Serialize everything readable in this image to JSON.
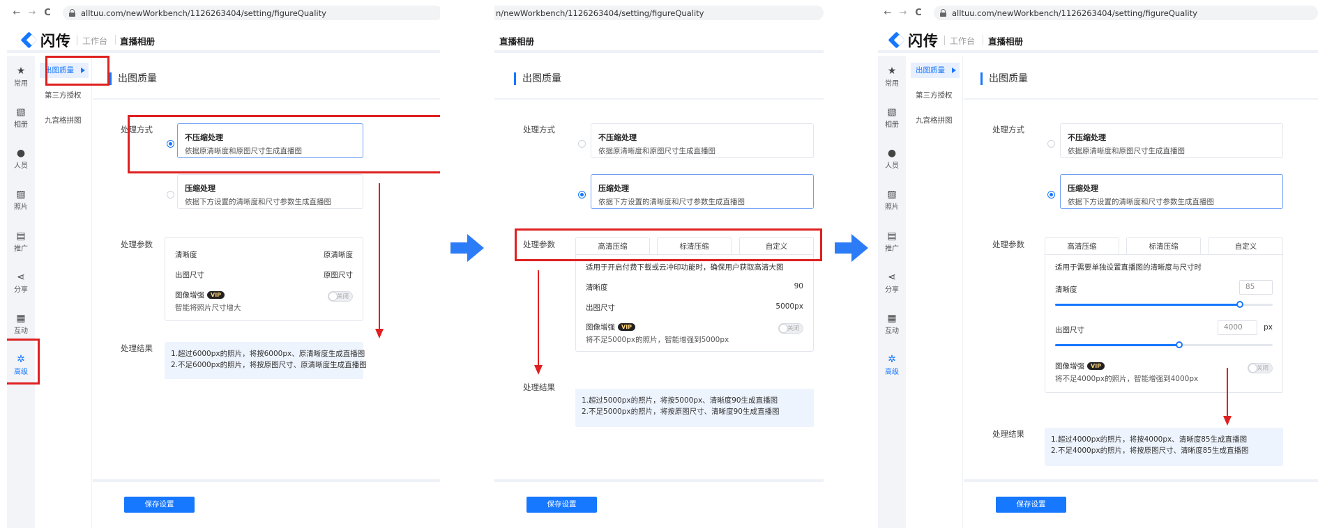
{
  "browser": {
    "back": "←",
    "forward": "→",
    "reload": "C",
    "url_full": "alltuu.com/newWorkbench/1126263404/setting/figureQuality",
    "url_scrolled": "n/newWorkbench/1126263404/setting/figureQuality"
  },
  "header": {
    "logo_name": "闪传",
    "logo_sub": "工作台",
    "title": "直播相册"
  },
  "icon_nav": [
    {
      "label": "常用",
      "icon": "star-icon",
      "glyph": "★"
    },
    {
      "label": "相册",
      "icon": "album-icon",
      "glyph": "▧"
    },
    {
      "label": "人员",
      "icon": "person-icon",
      "glyph": "●"
    },
    {
      "label": "照片",
      "icon": "photo-icon",
      "glyph": "▨"
    },
    {
      "label": "推广",
      "icon": "promote-icon",
      "glyph": "▤"
    },
    {
      "label": "分享",
      "icon": "share-icon",
      "glyph": "⋖"
    },
    {
      "label": "互动",
      "icon": "chat-icon",
      "glyph": "▦"
    },
    {
      "label": "高级",
      "icon": "gear-icon",
      "glyph": "✲"
    }
  ],
  "sub_nav": [
    "出图质量",
    "第三方授权",
    "九宫格拼图"
  ],
  "section_title": "出图质量",
  "labels": {
    "method": "处理方式",
    "params": "处理参数",
    "result": "处理结果"
  },
  "options": {
    "nocompress_title": "不压缩处理",
    "nocompress_desc": "依据原清晰度和原图尺寸生成直播图",
    "compress_title": "压缩处理",
    "compress_desc": "依据下方设置的清晰度和尺寸参数生成直播图"
  },
  "tabs": [
    "高清压缩",
    "标清压缩",
    "自定义"
  ],
  "panel1": {
    "clarity_label": "清晰度",
    "clarity_value": "原清晰度",
    "size_label": "出图尺寸",
    "size_value": "原图尺寸",
    "enhance_label": "图像增强",
    "enhance_desc": "智能将照片尺寸增大",
    "toggle_text": "关闭",
    "result_line1": "1.超过6000px的照片，将按6000px、原清晰度生成直播图",
    "result_line2": "2.不足6000px的照片，将按原图尺寸、原清晰度生成直播图"
  },
  "panel2": {
    "note": "适用于开启付费下载或云冲印功能时，确保用户获取高清大图",
    "clarity_label": "清晰度",
    "clarity_value": "90",
    "size_label": "出图尺寸",
    "size_value": "5000px",
    "enhance_label": "图像增强",
    "enhance_desc": "将不足5000px的照片，智能增强到5000px",
    "toggle_text": "关闭",
    "result_line1": "1.超过5000px的照片，将按5000px、清晰度90生成直播图",
    "result_line2": "2.不足5000px的照片，将按原图尺寸、清晰度90生成直播图"
  },
  "panel3": {
    "note": "适用于需要单独设置直播图的清晰度与尺寸时",
    "clarity_label": "清晰度",
    "clarity_value": "85",
    "clarity_fraction": 0.85,
    "size_label": "出图尺寸",
    "size_value": "4000",
    "size_unit": "px",
    "size_fraction": 0.57,
    "enhance_label": "图像增强",
    "enhance_desc": "将不足4000px的照片，智能增强到4000px",
    "toggle_text": "关闭",
    "result_line1": "1.超过4000px的照片，将按4000px、清晰度85生成直播图",
    "result_line2": "2.不足4000px的照片，将按原图尺寸、清晰度85生成直播图"
  },
  "vip_badge": "VIP",
  "save_label": "保存设置",
  "colors": {
    "accent": "#1677ff",
    "annotation": "#e02020",
    "result_bg": "#eef4fe"
  }
}
